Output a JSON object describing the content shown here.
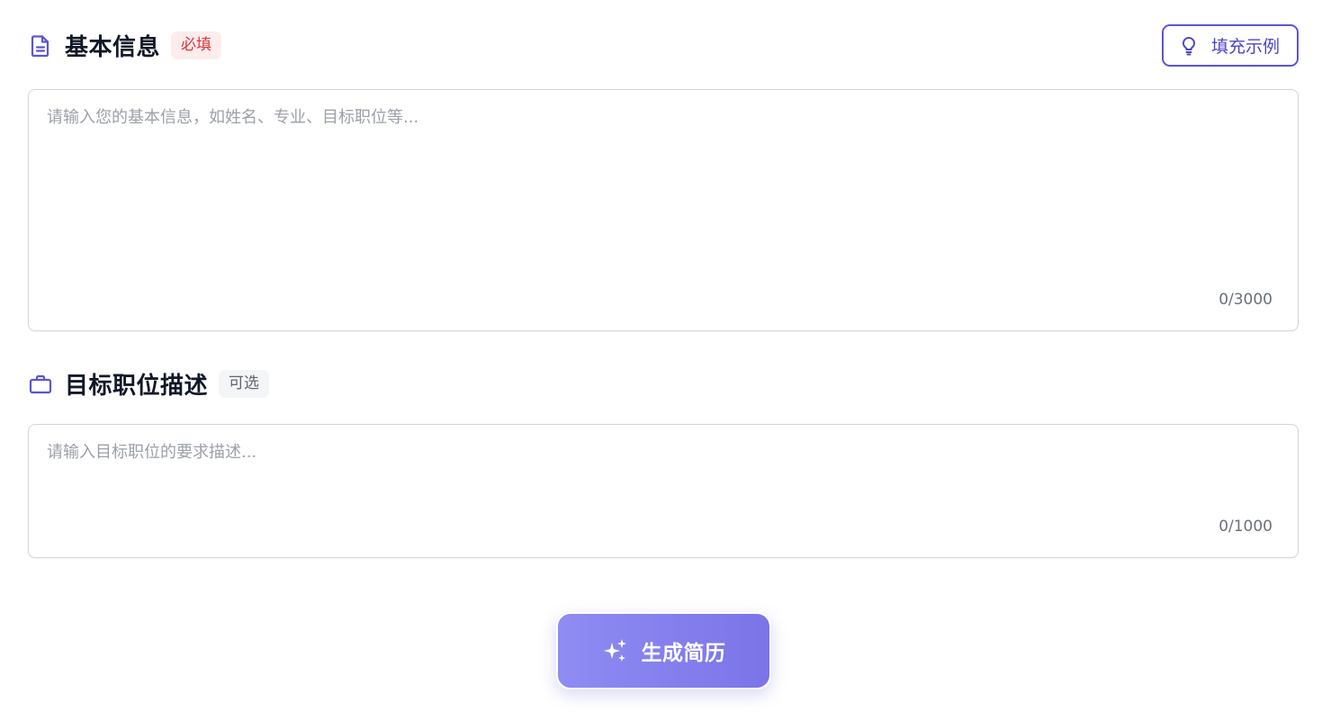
{
  "basic_info": {
    "title": "基本信息",
    "badge": "必填",
    "icon": "document-icon",
    "example_button": {
      "label": "填充示例",
      "icon": "lightbulb-icon"
    },
    "textarea": {
      "value": "",
      "placeholder": "请输入您的基本信息，如姓名、专业、目标职位等...",
      "counter": "0/3000"
    }
  },
  "job_description": {
    "title": "目标职位描述",
    "badge": "可选",
    "icon": "briefcase-icon",
    "textarea": {
      "value": "",
      "placeholder": "请输入目标职位的要求描述...",
      "counter": "0/1000"
    }
  },
  "generate_button": {
    "label": "生成简历",
    "icon": "sparkles-icon"
  },
  "colors": {
    "accent": "#5b55d6",
    "required_badge_bg": "#fdecec",
    "required_badge_text": "#d9363e",
    "optional_badge_bg": "#f4f5f7",
    "button_gradient_start": "#8f8cf3",
    "button_gradient_end": "#7b74e8"
  }
}
